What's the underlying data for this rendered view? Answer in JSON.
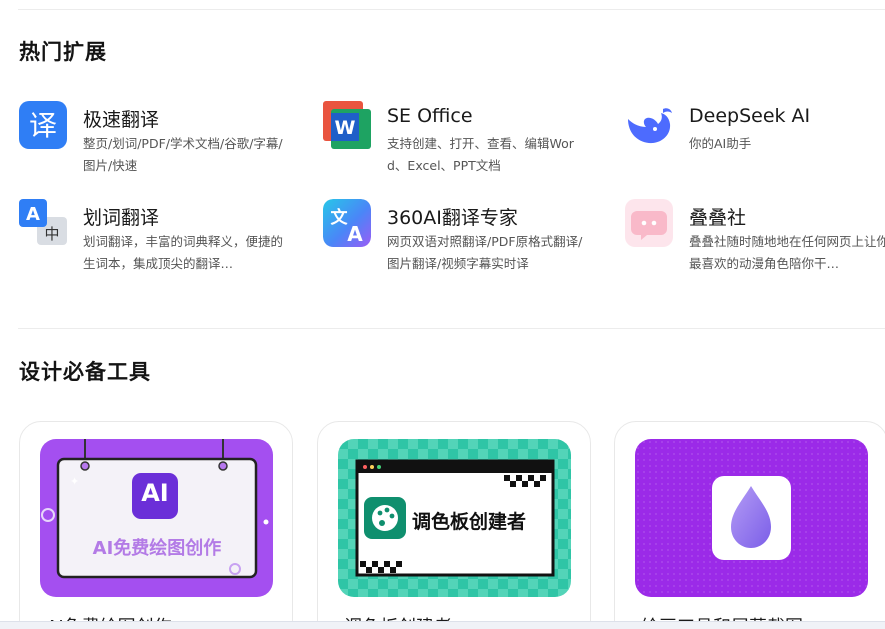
{
  "sections": {
    "hot_extensions": {
      "title": "热门扩展"
    },
    "design_tools": {
      "title": "设计必备工具"
    }
  },
  "extensions": [
    {
      "name": "极速翻译",
      "desc": "整页/划词/PDF/学术文档/谷歌/字幕/图片/快速",
      "icon": "translate-icon"
    },
    {
      "name": "SE Office",
      "desc": "支持创建、打开、查看、编辑Word、Excel、PPT文档",
      "icon": "word-office-icon"
    },
    {
      "name": "DeepSeek AI",
      "desc": "你的AI助手",
      "icon": "deepseek-whale-icon"
    },
    {
      "name": "划词翻译",
      "desc": "划词翻译，丰富的词典释义，便捷的生词本，集成顶尖的翻译…",
      "icon": "word-select-translate-icon"
    },
    {
      "name": "360AI翻译专家",
      "desc": "网页双语对照翻译/PDF原格式翻译/图片翻译/视频字幕实时译",
      "icon": "ai-translate-expert-icon"
    },
    {
      "name": "叠叠社",
      "desc": "叠叠社随时随地地在任何网页上让你最喜欢的动漫角色陪你干…",
      "icon": "anime-face-icon"
    }
  ],
  "design_cards": [
    {
      "title": "AI免费绘图创作",
      "banner_text": "AI免费绘图创作",
      "badge": "AI"
    },
    {
      "title": "调色板创建者",
      "banner_text": "调色板创建者"
    },
    {
      "title": "绘画工具和屏幕截图"
    }
  ]
}
